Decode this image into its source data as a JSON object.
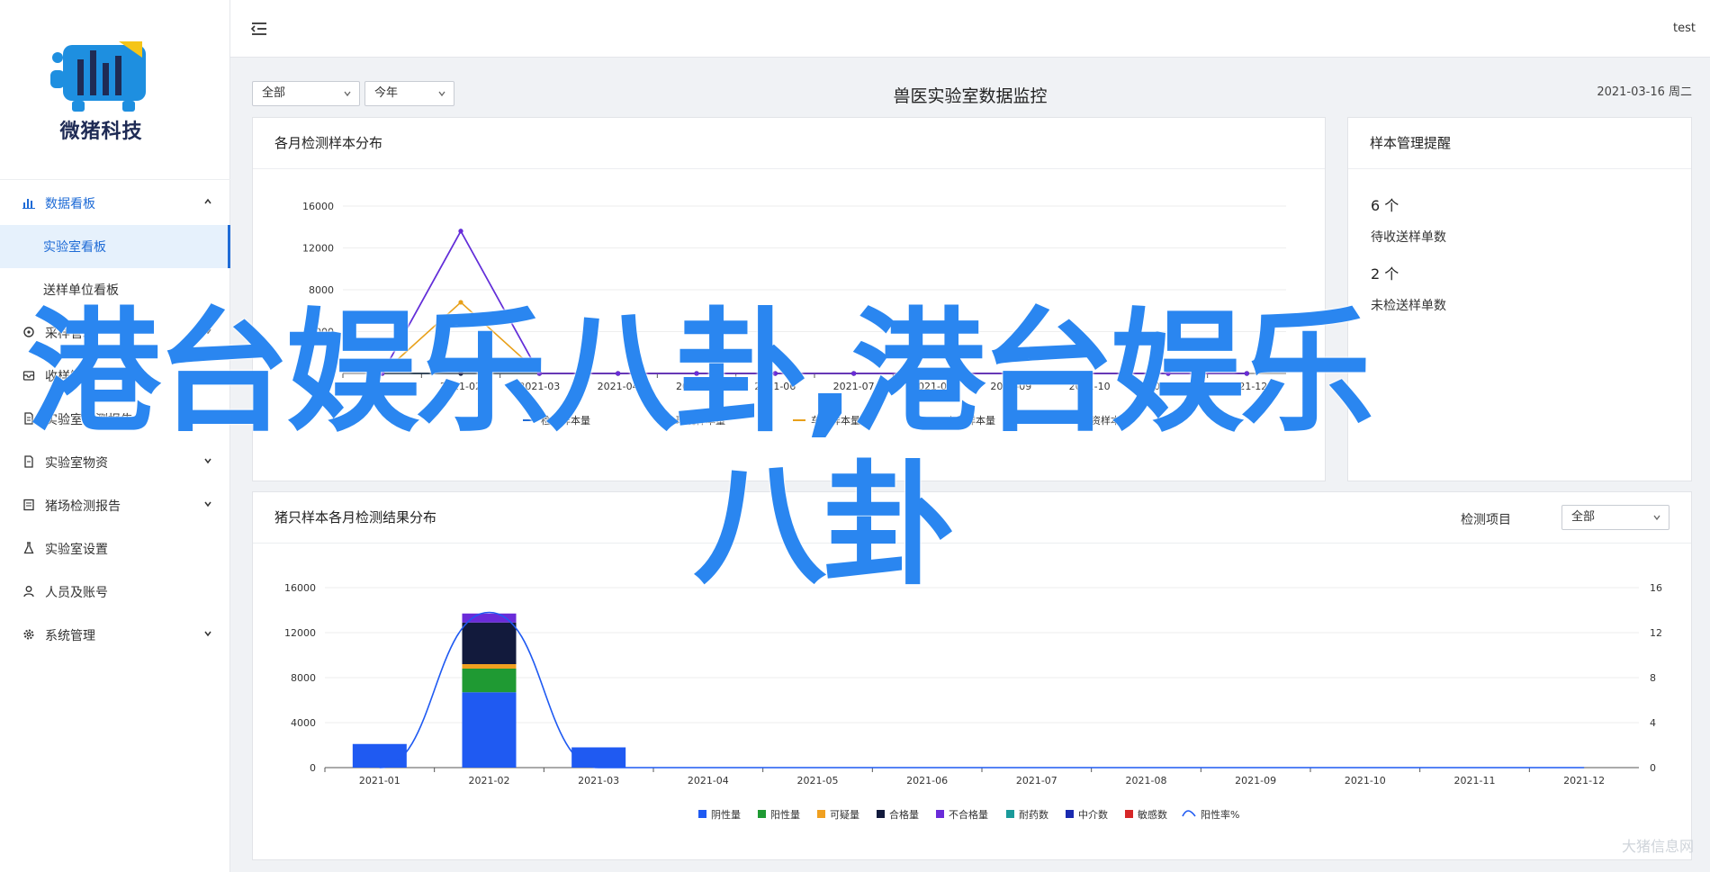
{
  "brand": {
    "name": "微猪科技",
    "colors": {
      "primary": "#1e6bd6",
      "logo_blue": "#1e8fe0",
      "logo_dark": "#1f2b55",
      "logo_yellow": "#f5c518"
    }
  },
  "topbar": {
    "user": "test"
  },
  "sidebar": {
    "groups": [
      {
        "label": "数据看板",
        "icon": "bar-chart-icon",
        "open": true,
        "children": [
          {
            "label": "实验室看板",
            "active": true
          },
          {
            "label": "送样单位看板",
            "active": false
          }
        ]
      },
      {
        "label": "采样管理",
        "icon": "sampling-icon",
        "open": false
      },
      {
        "label": "收样管理",
        "icon": "receive-icon",
        "open": false
      },
      {
        "label": "实验室检测报告",
        "icon": "report-icon",
        "open": false
      },
      {
        "label": "实验室物资",
        "icon": "supplies-icon",
        "open": false
      },
      {
        "label": "猪场检测报告",
        "icon": "farm-report-icon",
        "open": false
      },
      {
        "label": "实验室设置",
        "icon": "flask-icon",
        "open": false
      },
      {
        "label": "人员及账号",
        "icon": "user-icon",
        "open": false
      },
      {
        "label": "系统管理",
        "icon": "gear-icon",
        "open": false
      }
    ]
  },
  "filters": {
    "scope": {
      "value": "全部"
    },
    "year": {
      "value": "今年"
    },
    "detect_item_label": "检测项目",
    "detect_item": {
      "value": "全部"
    }
  },
  "page": {
    "title": "兽医实验室数据监控",
    "date": "2021-03-16 周二"
  },
  "card_monthly": {
    "title": "各月检测样本分布"
  },
  "card_reminder": {
    "title": "样本管理提醒",
    "items": [
      {
        "value": "6 个",
        "label": "待收送样单数"
      },
      {
        "value": "2 个",
        "label": "未检送样单数"
      }
    ]
  },
  "card_pig": {
    "title": "猪只样本各月检测结果分布"
  },
  "chart_data": [
    {
      "type": "line",
      "title": "各月检测样本分布",
      "categories": [
        "2021-01",
        "2021-02",
        "2021-03",
        "2021-04",
        "2021-05",
        "2021-06",
        "2021-07",
        "2021-08",
        "2021-09",
        "2021-10",
        "2021-11",
        "2021-12"
      ],
      "yticks": [
        "0",
        "4000",
        "8000",
        "12000",
        "16000"
      ],
      "ylim": [
        0,
        16000
      ],
      "series": [
        {
          "name": "检测样本量",
          "color": "#1e6bd6",
          "values": [
            0,
            13600,
            0,
            0,
            0,
            0,
            0,
            0,
            0,
            0,
            0,
            0
          ]
        },
        {
          "name": "环境样本量",
          "color": "#2ca02c",
          "values": [
            0,
            0,
            0,
            0,
            0,
            0,
            0,
            0,
            0,
            0,
            0,
            0
          ]
        },
        {
          "name": "车辆样本量",
          "color": "#e8a019",
          "values": [
            0,
            6800,
            0,
            0,
            0,
            0,
            0,
            0,
            0,
            0,
            0,
            0
          ]
        },
        {
          "name": "人员样本量",
          "color": "#1a1f4a",
          "values": [
            0,
            0,
            0,
            0,
            0,
            0,
            0,
            0,
            0,
            0,
            0,
            0
          ]
        },
        {
          "name": "物资样本量",
          "color": "#6a2bd9",
          "values": [
            0,
            13600,
            0,
            0,
            0,
            0,
            0,
            0,
            0,
            0,
            0,
            0
          ]
        }
      ],
      "legend": "bottom"
    },
    {
      "type": "bar",
      "title": "猪只样本各月检测结果分布",
      "stacked": true,
      "categories": [
        "2021-01",
        "2021-02",
        "2021-03",
        "2021-04",
        "2021-05",
        "2021-06",
        "2021-07",
        "2021-08",
        "2021-09",
        "2021-10",
        "2021-11",
        "2021-12"
      ],
      "yticks": [
        "0",
        "4000",
        "8000",
        "12000",
        "16000"
      ],
      "ylim": [
        0,
        16000
      ],
      "y2ticks": [
        "0",
        "4",
        "8",
        "12",
        "16"
      ],
      "y2lim": [
        0,
        16
      ],
      "series": [
        {
          "name": "阴性量",
          "color": "#1f5af2",
          "values": [
            2100,
            6700,
            1800,
            0,
            0,
            0,
            0,
            0,
            0,
            0,
            0,
            0
          ]
        },
        {
          "name": "阳性量",
          "color": "#1f9a33",
          "values": [
            0,
            2100,
            0,
            0,
            0,
            0,
            0,
            0,
            0,
            0,
            0,
            0
          ]
        },
        {
          "name": "可疑量",
          "color": "#f0a020",
          "values": [
            0,
            400,
            0,
            0,
            0,
            0,
            0,
            0,
            0,
            0,
            0,
            0
          ]
        },
        {
          "name": "合格量",
          "color": "#121a3c",
          "values": [
            0,
            3700,
            0,
            0,
            0,
            0,
            0,
            0,
            0,
            0,
            0,
            0
          ]
        },
        {
          "name": "不合格量",
          "color": "#6a2bd9",
          "values": [
            0,
            800,
            0,
            0,
            0,
            0,
            0,
            0,
            0,
            0,
            0,
            0
          ]
        },
        {
          "name": "耐药数",
          "color": "#1a9a9a",
          "values": [
            0,
            0,
            0,
            0,
            0,
            0,
            0,
            0,
            0,
            0,
            0,
            0
          ]
        },
        {
          "name": "中介数",
          "color": "#1a2ab0",
          "values": [
            0,
            0,
            0,
            0,
            0,
            0,
            0,
            0,
            0,
            0,
            0,
            0
          ]
        },
        {
          "name": "敏感数",
          "color": "#d62728",
          "values": [
            0,
            0,
            0,
            0,
            0,
            0,
            0,
            0,
            0,
            0,
            0,
            0
          ]
        }
      ],
      "line_series": {
        "name": "阳性率%",
        "color": "#1f5af2",
        "values": [
          0,
          13.8,
          0,
          0,
          0,
          0,
          0,
          0,
          0,
          0,
          0,
          0
        ],
        "axis": "right"
      },
      "legend": "bottom"
    }
  ],
  "overlay": {
    "line1": "港台娱乐八卦,港台娱乐",
    "line2": "八卦"
  },
  "corner_watermark": "大猪信息网"
}
